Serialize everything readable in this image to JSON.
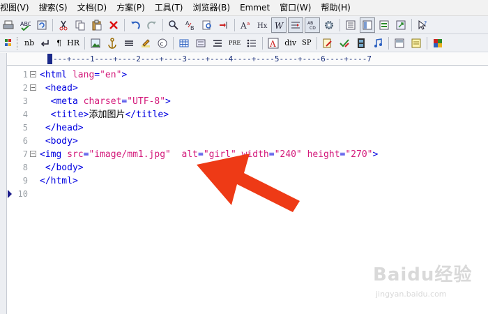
{
  "menubar": {
    "items": [
      "视图(V)",
      "搜索(S)",
      "文档(D)",
      "方案(P)",
      "工具(T)",
      "浏览器(B)",
      "Emmet",
      "窗口(W)",
      "帮助(H)"
    ]
  },
  "toolbar2": {
    "nb": "nb",
    "paragraph": "¶",
    "hr": "HR",
    "pre": "PRE",
    "div": "div",
    "sp": "SP"
  },
  "ruler": {
    "text": "---+----1----+----2----+----3----+----4----+----5----+----6----+----7"
  },
  "editor": {
    "lines": [
      {
        "num": "1",
        "parts": [
          {
            "cls": "tag",
            "t": "<html "
          },
          {
            "cls": "attr",
            "t": "lang"
          },
          {
            "cls": "tag",
            "t": "="
          },
          {
            "cls": "val",
            "t": "\"en\""
          },
          {
            "cls": "tag",
            "t": ">"
          }
        ]
      },
      {
        "num": "2",
        "parts": [
          {
            "cls": "tag",
            "t": " <head>"
          }
        ]
      },
      {
        "num": "3",
        "parts": [
          {
            "cls": "tag",
            "t": "  <meta "
          },
          {
            "cls": "attr",
            "t": "charset"
          },
          {
            "cls": "tag",
            "t": "="
          },
          {
            "cls": "val",
            "t": "\"UTF-8\""
          },
          {
            "cls": "tag",
            "t": ">"
          }
        ]
      },
      {
        "num": "4",
        "parts": [
          {
            "cls": "tag",
            "t": "  <title>"
          },
          {
            "cls": "txt",
            "t": "添加图片"
          },
          {
            "cls": "tag",
            "t": "</title>"
          }
        ]
      },
      {
        "num": "5",
        "parts": [
          {
            "cls": "tag",
            "t": " </head>"
          }
        ]
      },
      {
        "num": "6",
        "parts": [
          {
            "cls": "tag",
            "t": " <body>"
          }
        ]
      },
      {
        "num": "7",
        "parts": [
          {
            "cls": "tag",
            "t": "<img "
          },
          {
            "cls": "attr",
            "t": "src"
          },
          {
            "cls": "tag",
            "t": "="
          },
          {
            "cls": "val",
            "t": "\"image/mm1.jpg\""
          },
          {
            "cls": "tag",
            "t": "  "
          },
          {
            "cls": "attr",
            "t": "alt"
          },
          {
            "cls": "tag",
            "t": "="
          },
          {
            "cls": "val",
            "t": "\"girl\""
          },
          {
            "cls": "tag",
            "t": " "
          },
          {
            "cls": "attr",
            "t": "width"
          },
          {
            "cls": "tag",
            "t": "="
          },
          {
            "cls": "val",
            "t": "\"240\""
          },
          {
            "cls": "tag",
            "t": " "
          },
          {
            "cls": "attr",
            "t": "height"
          },
          {
            "cls": "tag",
            "t": "="
          },
          {
            "cls": "val",
            "t": "\"270\""
          },
          {
            "cls": "tag",
            "t": ">"
          }
        ]
      },
      {
        "num": "8",
        "parts": [
          {
            "cls": "tag",
            "t": " </body>"
          }
        ]
      },
      {
        "num": "9",
        "parts": [
          {
            "cls": "tag",
            "t": "</html>"
          }
        ]
      },
      {
        "num": "10",
        "parts": []
      }
    ]
  },
  "colors": {
    "tag": "#0000e0",
    "attribute": "#d3197a",
    "arrow": "#ee3a16"
  },
  "watermark": {
    "brand": "Baidu经验",
    "url": "jingyan.baidu.com"
  }
}
